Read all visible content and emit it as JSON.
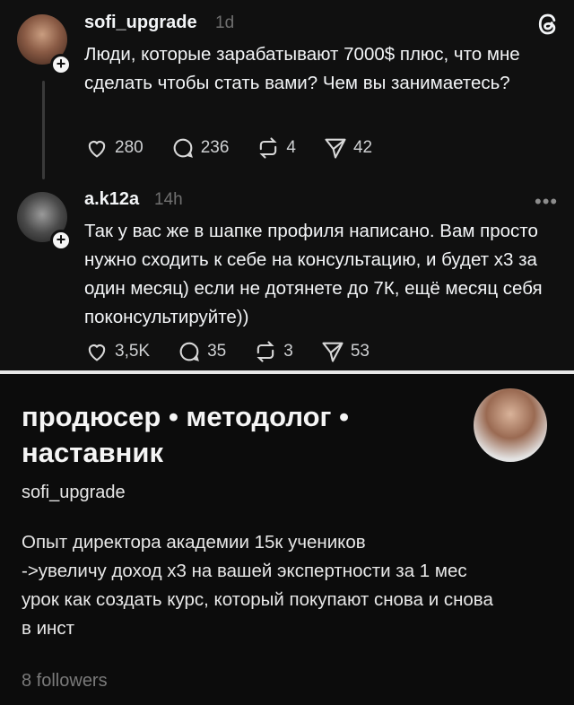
{
  "post1": {
    "username": "sofi_upgrade",
    "time": "1d",
    "text": "Люди, которые зарабатывают 7000$ плюс, что мне сделать чтобы стать вами? Чем вы занимаетесь?",
    "likes": "280",
    "comments": "236",
    "reposts": "4",
    "shares": "42",
    "avatar_icon": "user-avatar",
    "follow_icon": "plus-icon"
  },
  "post2": {
    "username": "a.k12a",
    "time": "14h",
    "text": "Так у вас же в шапке профиля написано. Вам просто нужно сходить к себе на консультацию, и будет х3 за один месяц) если не дотянете до 7К, ещё месяц себя поконсультируйте))",
    "likes": "3,5K",
    "comments": "35",
    "reposts": "3",
    "shares": "53",
    "more_icon": "more-horizontal-icon"
  },
  "profile": {
    "name": "продюсер • методолог • наставник",
    "handle": "sofi_upgrade",
    "bio_lines": [
      "Опыт директора академии 15к учеников",
      "->увеличу доход х3 на вашей экспертности за 1 мес",
      "урок как создать курс, который покупают снова и снова",
      "в инст"
    ],
    "followers": "8 followers"
  },
  "colors": {
    "background": "#101010",
    "text": "#f3f5f7",
    "muted": "#6f6f6f",
    "divider": "#e8e8e8"
  }
}
